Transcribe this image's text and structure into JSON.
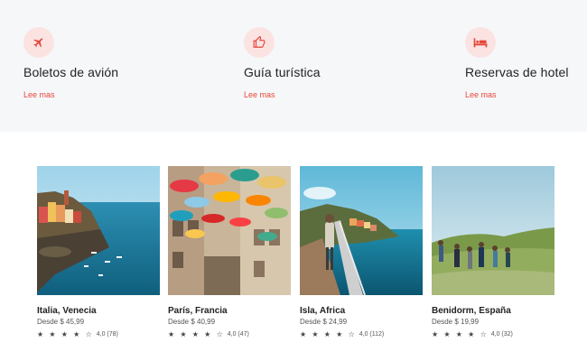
{
  "colors": {
    "accent": "#e5473a",
    "icon_bg": "#fbe3e2",
    "band_bg": "#f6f7f9"
  },
  "services": [
    {
      "icon": "airplane-icon",
      "title": "Boletos de avión",
      "link": "Lee mas"
    },
    {
      "icon": "thumbs-up-icon",
      "title": "Guía turística",
      "link": "Lee mas"
    },
    {
      "icon": "bed-icon",
      "title": "Reservas de hotel",
      "link": "Lee mas"
    }
  ],
  "destinations": [
    {
      "name": "Italia, Venecia",
      "price": "Desde $ 45,99",
      "stars": "★ ★ ★ ★ ☆",
      "rating": 4.0,
      "rating_text": "4,0 (78)"
    },
    {
      "name": "París, Francia",
      "price": "Desde $ 40,99",
      "stars": "★ ★ ★ ★ ☆",
      "rating": 4.0,
      "rating_text": "4,0 (47)"
    },
    {
      "name": "Isla, Africa",
      "price": "Desde $ 24,99",
      "stars": "★ ★ ★ ★ ☆",
      "rating": 4.0,
      "rating_text": "4,0 (112)"
    },
    {
      "name": "Benidorm, España",
      "price": "Desde $ 19,99",
      "stars": "★ ★ ★ ★ ☆",
      "rating": 4.0,
      "rating_text": "4,0 (32)"
    }
  ]
}
